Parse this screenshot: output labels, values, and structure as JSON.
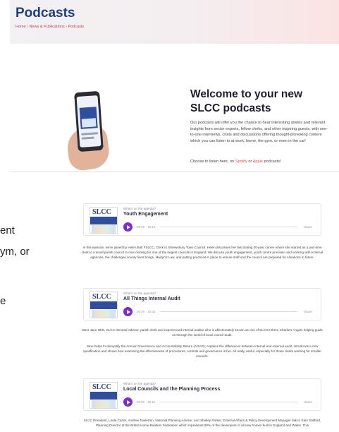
{
  "header": {
    "title": "Podcasts",
    "breadcrumb": "Home › News & Publications › Podcasts"
  },
  "welcome": {
    "title": "Welcome to your new SLCC podcasts",
    "body": "Our podcasts will offer you the chance to hear interesting stories and relevant insights from sector experts, fellow clerks, and other inspiring guests, with one-to-one interviews, chats and discussions offering thought-provoking content which you can listen to at work, home, the gym, or even in the car!",
    "listen_prefix": "Choose to listen here, on ",
    "spotify": "Spotify",
    "or": " or ",
    "apple": "Apple",
    "listen_suffix": " podcasts!"
  },
  "cropped_left": [
    "ent",
    "ym, or",
    "e"
  ],
  "episodes": [
    {
      "kicker": "What's on the agenda?",
      "title": "Youth Engagement",
      "time": "00:00 · 15:15",
      "share": "Share",
      "description": [
        "In this episode, we're joined by Helen Ball FSLCC, Clerk to Shrewsbury Town Council. Helen discusses her fascinating 30-year career where she started as a part-time clerk to a small parish council to now clerking for one of the largest councils in England. We discuss youth engagement, youth centre provision and working with external agencies, the challenges county lines brings, Martyn's Law, and putting practices in place to ensure staff and the council are prepared for situations in future."
      ]
    },
    {
      "kicker": "What's on the agenda?",
      "title": "All Things Internal Audit",
      "time": "00:00 · 19:32",
      "share": "Share",
      "description": [
        "Meet Jane Olds, SLCC General Advisor, parish clerk and experienced internal auditor who is affectionately known as one of SLCC's three Charlie's Angels helping guide us through the world of local council audit.",
        "Jane helps to demystify the Annual Governance and Accountability Return (AGAR), explains the differences between internal and external audit, introduces a new qualification and shows how examining the effectiveness of procedures, controls and governance is fun. All really useful, especially for those clerks working for smaller councils."
      ]
    },
    {
      "kicker": "What's on the agenda?",
      "title": "Local Councils and the Planning Process",
      "time": "00:00 · 46:11",
      "share": "Share",
      "description": [
        "SLCC President, Linda Carter, Andrew Towlerton, National Planning Advisor, and Shelley Parker, External Affairs & Policy Development Manager talk to Sam Stafford, Planning Director at the British Home Builders Federation which represents 80% of the developers of all new homes built in England and Wales. This"
      ]
    }
  ],
  "cover": {
    "logo": "SLCC",
    "band": "WHAT'S ON THE AGENDA?"
  },
  "colors": {
    "brand_blue": "#1f3c8a",
    "accent_red": "#e05050",
    "play_purple": "#7b2bd6"
  }
}
